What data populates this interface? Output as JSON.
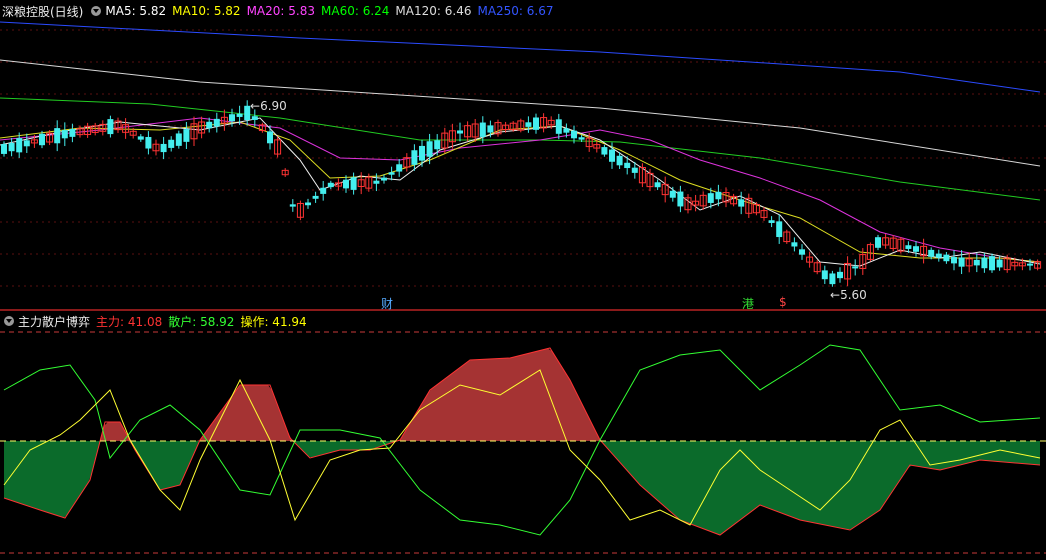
{
  "main": {
    "title": "深粮控股(日线)",
    "indicators": [
      {
        "label": "MA5: 5.82",
        "color": "#ffffff"
      },
      {
        "label": "MA10: 5.82",
        "color": "#ffff00"
      },
      {
        "label": "MA20: 5.83",
        "color": "#ff44ff"
      },
      {
        "label": "MA60: 6.24",
        "color": "#00ff00"
      },
      {
        "label": "MA120: 6.46",
        "color": "#dddddd"
      },
      {
        "label": "MA250: 6.67",
        "color": "#3355ff"
      }
    ],
    "high_marker": "6.90",
    "low_marker": "5.60",
    "event_markers": [
      {
        "label": "财",
        "color": "#55aaff"
      },
      {
        "label": "港",
        "color": "#33dd33"
      },
      {
        "label": "$",
        "color": "#ff4444"
      }
    ]
  },
  "sub": {
    "title": "主力散户博弈",
    "indicators": [
      {
        "label": "主力: 41.08",
        "color": "#ff3333"
      },
      {
        "label": "散户: 58.92",
        "color": "#33ff33"
      },
      {
        "label": "操作: 41.94",
        "color": "#ffff00"
      }
    ]
  },
  "colors": {
    "up": "#ff3333",
    "down": "#44eeee",
    "fill_up": "#a53333",
    "fill_down": "#0b6b2b"
  }
}
